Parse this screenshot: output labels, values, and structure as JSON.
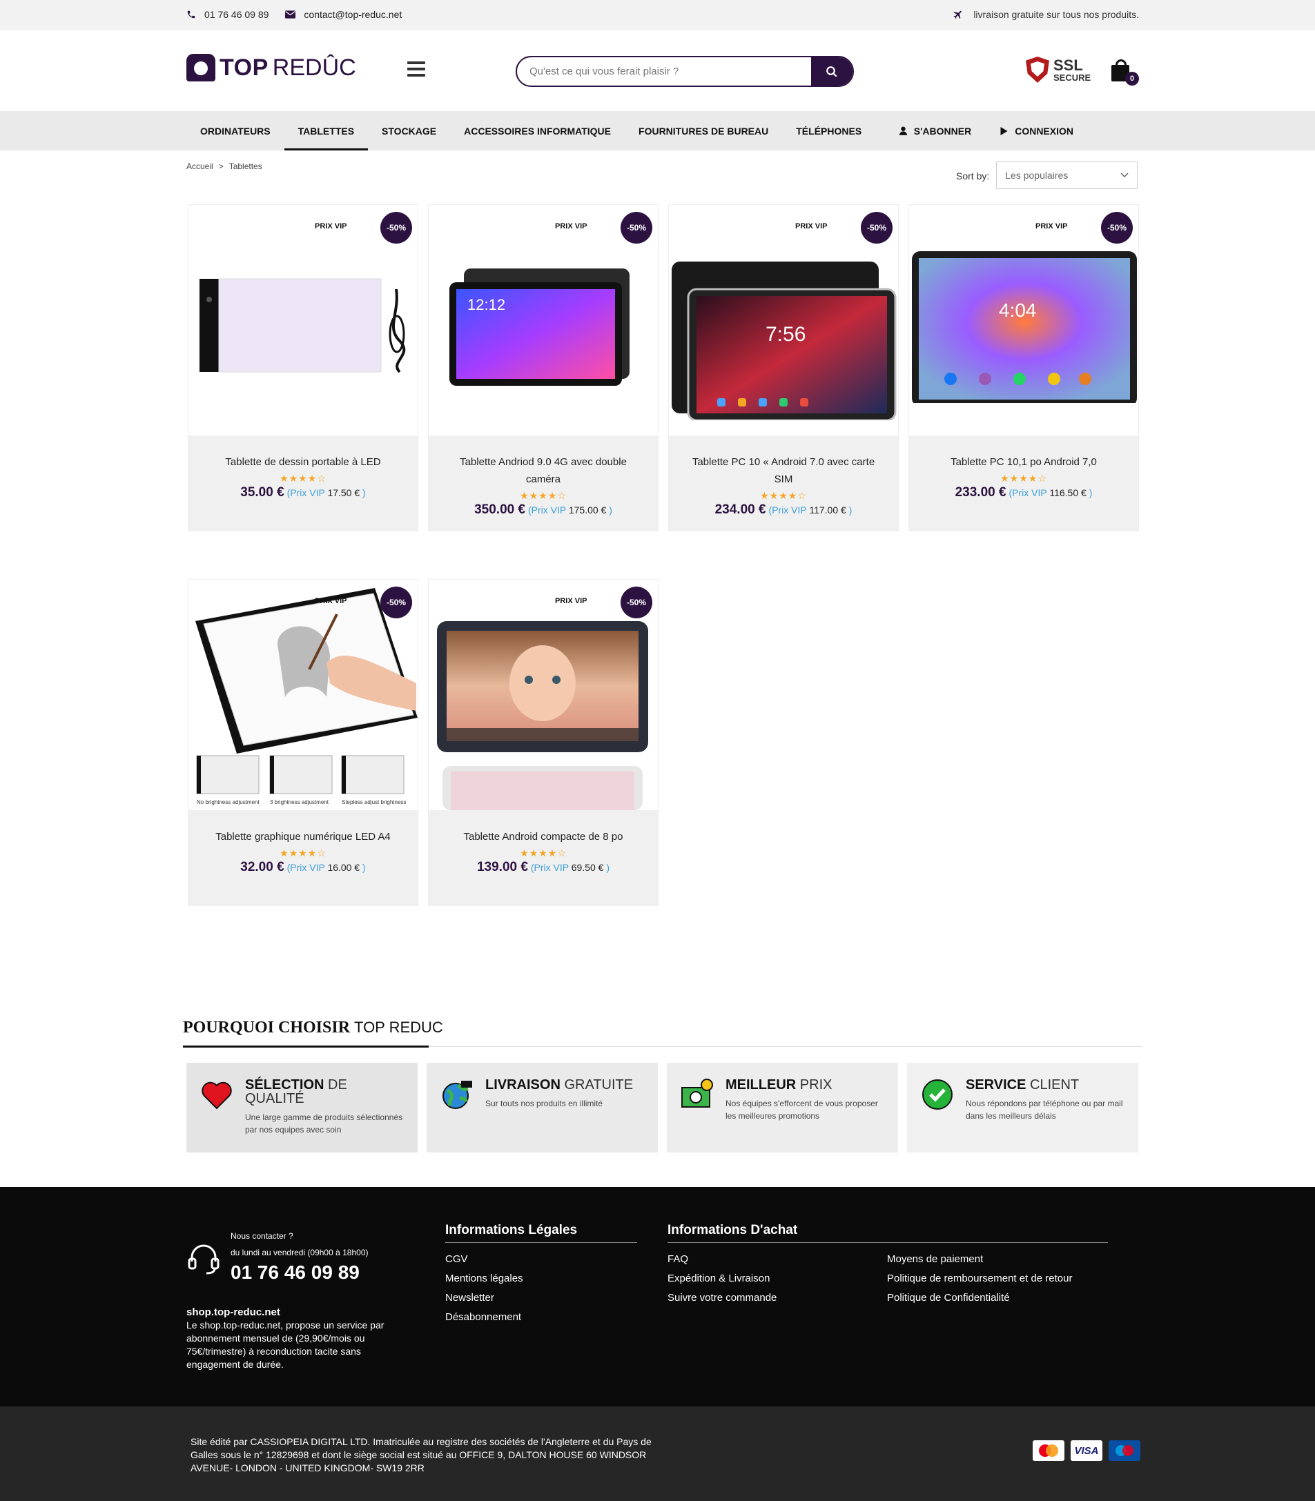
{
  "topbar": {
    "phone": "01 76 46 09 89",
    "email": "contact@top-reduc.net",
    "shipping": "livraison gratuite sur tous nos produits."
  },
  "header": {
    "logo_bold": "TOP",
    "logo_light": "REDÛC",
    "search_placeholder": "Qu'est ce qui vous ferait plaisir ?",
    "ssl_title": "SSL",
    "ssl_sub": "SECURE",
    "cart_count": "0"
  },
  "nav": {
    "items": [
      {
        "label": "ORDINATEURS",
        "active": false
      },
      {
        "label": "TABLETTES",
        "active": true
      },
      {
        "label": "STOCKAGE",
        "active": false
      },
      {
        "label": "ACCESSOIRES INFORMATIQUE",
        "active": false
      },
      {
        "label": "FOURNITURES DE BUREAU",
        "active": false
      },
      {
        "label": "TÉLÉPHONES",
        "active": false
      }
    ],
    "subscribe": "S'ABONNER",
    "login": "CONNEXION"
  },
  "breadcrumb": {
    "home": "Accueil",
    "sep": ">",
    "current": "Tablettes"
  },
  "sort": {
    "label": "Sort by:",
    "value": "Les populaires"
  },
  "products": [
    {
      "name": "Tablette de dessin portable à LED",
      "badge": "PRIX VIP",
      "discount": "-50%",
      "price": "35.00 €",
      "vip_label": "(Prix VIP",
      "vip_price": "17.50 €",
      "vip_close": ")",
      "stars": "★★★★☆",
      "rating": 4
    },
    {
      "name": "Tablette Andriod 9.0 4G avec double caméra",
      "badge": "PRIX VIP",
      "discount": "-50%",
      "price": "350.00 €",
      "vip_label": "(Prix VIP",
      "vip_price": "175.00 €",
      "vip_close": ")",
      "stars": "★★★★☆",
      "rating": 4
    },
    {
      "name": "Tablette PC 10 « Android 7.0 avec carte SIM",
      "badge": "PRIX VIP",
      "discount": "-50%",
      "price": "234.00 €",
      "vip_label": "(Prix VIP",
      "vip_price": "117.00 €",
      "vip_close": ")",
      "stars": "★★★★☆",
      "rating": 4
    },
    {
      "name": "Tablette PC 10,1 po Android 7,0",
      "badge": "PRIX VIP",
      "discount": "-50%",
      "price": "233.00 €",
      "vip_label": "(Prix VIP",
      "vip_price": "116.50 €",
      "vip_close": ")",
      "stars": "★★★★☆",
      "rating": 4
    },
    {
      "name": "Tablette graphique numérique LED A4",
      "badge": "PRIX VIP",
      "discount": "-50%",
      "price": "32.00 €",
      "vip_label": "(Prix VIP",
      "vip_price": "16.00 €",
      "vip_close": ")",
      "stars": "★★★★☆",
      "rating": 4
    },
    {
      "name": "Tablette Android compacte de 8 po",
      "badge": "PRIX VIP",
      "discount": "-50%",
      "price": "139.00 €",
      "vip_label": "(Prix VIP",
      "vip_price": "69.50 €",
      "vip_close": ")",
      "stars": "★★★★☆",
      "rating": 4
    }
  ],
  "product_image_captions": {
    "screen_time_2": "12:12",
    "screen_time_3": "7:56",
    "screen_time_4": "4:04",
    "sub1": "No brightness adjustment",
    "sub2": "3 brightness adjustment",
    "sub3": "Stepless adjust brightness"
  },
  "why": {
    "title_bold": "POURQUOI CHOISIR",
    "title_light": "TOP REDUC",
    "features": [
      {
        "bold": "SÉLECTION",
        "light": "DE QUALITÉ",
        "desc": "Une large gamme de produits sélectionnés par nos equipes avec soin",
        "icon": "heart-icon"
      },
      {
        "bold": "LIVRAISON",
        "light": "GRATUITE",
        "desc": "Sur touts nos produits en illimité",
        "icon": "globe-cart-icon"
      },
      {
        "bold": "MEILLEUR",
        "light": "PRIX",
        "desc": "Nos équipes s'efforcent de vous proposer les meilleures promotions",
        "icon": "money-icon"
      },
      {
        "bold": "SERVICE",
        "light": "CLIENT",
        "desc": "Nous répondons par téléphone ou par mail dans les meilleurs délais",
        "icon": "check-icon"
      }
    ]
  },
  "footer": {
    "contact_q": "Nous contacter ?",
    "hours": "du lundi au vendredi (09h00 à 18h00)",
    "phone": "01 76 46 09 89",
    "site": "shop.top-reduc.net",
    "about": "Le shop.top-reduc.net, propose un service par abonnement mensuel de (29,90€/mois ou 75€/trimestre) à reconduction tacite sans engagement de durée.",
    "legal_title": "Informations Légales",
    "legal_links": [
      "CGV",
      "Mentions légales",
      "Newsletter",
      "Désabonnement"
    ],
    "purchase_title": "Informations D'achat",
    "purchase_links_a": [
      "FAQ",
      "Expédition & Livraison",
      "Suivre votre commande"
    ],
    "purchase_links_b": [
      "Moyens de paiement",
      "Politique de remboursement et de retour",
      "Politique de Confidentialité"
    ]
  },
  "bottom": {
    "legal": "Site édité par CASSIOPEIA DIGITAL LTD. Imatriculée au registre des sociétés de l'Angleterre et du Pays de Galles sous le n° 12829698 et dont le siège social est situé au OFFICE 9, DALTON HOUSE 60 WINDSOR AVENUE- LONDON - UNITED KINGDOM- SW19 2RR",
    "payments": [
      "MasterCard",
      "VISA",
      "Maestro"
    ]
  },
  "colors": {
    "brand": "#2c1240",
    "vip": "#3ca0dc",
    "stars": "#f5a623",
    "footer": "#0b0b0b"
  }
}
